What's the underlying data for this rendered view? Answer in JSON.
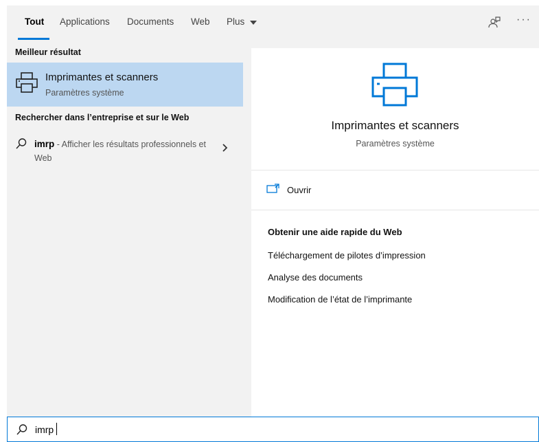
{
  "tabs": [
    {
      "label": "Tout",
      "active": true
    },
    {
      "label": "Applications",
      "active": false
    },
    {
      "label": "Documents",
      "active": false
    },
    {
      "label": "Web",
      "active": false
    },
    {
      "label": "Plus",
      "active": false
    }
  ],
  "top_icons": [
    "feedback-icon",
    "more-icon"
  ],
  "more_label": "···",
  "left": {
    "best_match_title": "Meilleur résultat",
    "best_match": {
      "title": "Imprimantes et scanners",
      "subtitle": "Paramètres système",
      "icon": "printer-icon"
    },
    "web_section_title": "Rechercher dans l’entreprise et sur le Web",
    "web_result": {
      "query": "imrp",
      "description": " - Afficher les résultats professionnels et Web"
    }
  },
  "right": {
    "title": "Imprimantes et scanners",
    "subtitle": "Paramètres système",
    "open_label": "Ouvrir",
    "help_title": "Obtenir une aide rapide du Web",
    "help_links": [
      "Téléchargement de pilotes d’impression",
      "Analyse des documents",
      "Modification de l’état de l’imprimante"
    ]
  },
  "search": {
    "value": "imrp"
  },
  "colors": {
    "accent": "#0078d7",
    "selected_bg": "#bcd7f1",
    "pane_bg": "#f2f2f2"
  }
}
